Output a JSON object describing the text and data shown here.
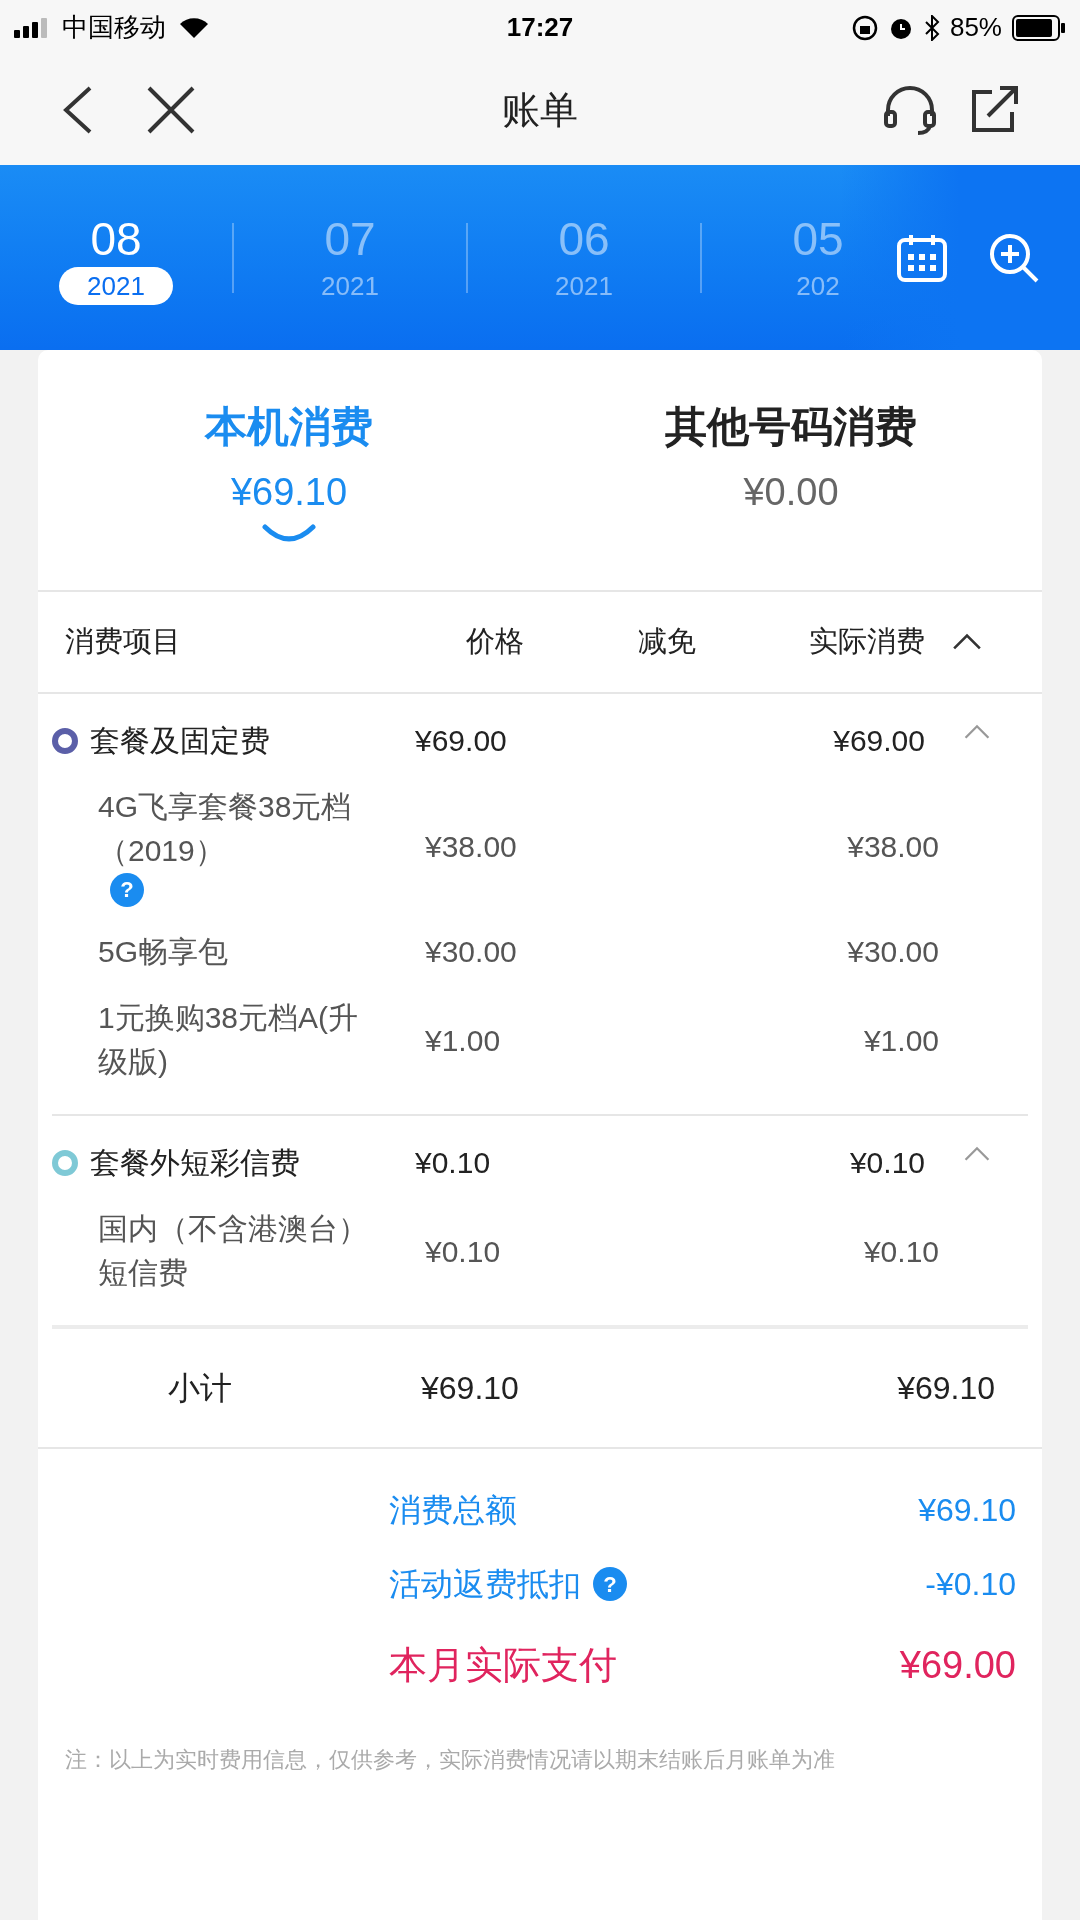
{
  "status_bar": {
    "carrier": "中国移动",
    "time": "17:27",
    "battery": "85%"
  },
  "nav": {
    "title": "账单"
  },
  "months": [
    {
      "month": "08",
      "year": "2021",
      "selected": true
    },
    {
      "month": "07",
      "year": "2021",
      "selected": false
    },
    {
      "month": "06",
      "year": "2021",
      "selected": false
    },
    {
      "month": "05",
      "year": "202",
      "selected": false
    }
  ],
  "summary_tabs": [
    {
      "label": "本机消费",
      "amount": "¥69.10",
      "selected": true
    },
    {
      "label": "其他号码消费",
      "amount": "¥0.00",
      "selected": false
    }
  ],
  "table": {
    "columns": [
      "消费项目",
      "价格",
      "减免",
      "实际消费"
    ],
    "expanded": true,
    "groups": [
      {
        "name": "套餐及固定费",
        "price": "¥69.00",
        "actual": "¥69.00",
        "color": "#5b5fa8",
        "expanded": true,
        "items": [
          {
            "name": "4G飞享套餐38元档（2019）",
            "price": "¥38.00",
            "actual": "¥38.00",
            "help": "?"
          },
          {
            "name": "5G畅享包",
            "price": "¥30.00",
            "actual": "¥30.00"
          },
          {
            "name": "1元换购38元档A(升级版)",
            "price": "¥1.00",
            "actual": "¥1.00"
          }
        ]
      },
      {
        "name": "套餐外短彩信费",
        "price": "¥0.10",
        "actual": "¥0.10",
        "color": "#7fc9d6",
        "expanded": true,
        "items": [
          {
            "name": "国内（不含港澳台）短信费",
            "price": "¥0.10",
            "actual": "¥0.10"
          }
        ]
      }
    ],
    "subtotal": {
      "label": "小计",
      "price": "¥69.10",
      "actual": "¥69.10"
    }
  },
  "totals": [
    {
      "label": "消费总额",
      "value": "¥69.10",
      "kind": "normal"
    },
    {
      "label": "活动返费抵扣",
      "value": "-¥0.10",
      "kind": "normal",
      "help": "?"
    },
    {
      "label": "本月实际支付",
      "value": "¥69.00",
      "kind": "final"
    }
  ],
  "note": "注：以上为实时费用信息，仅供参考，实际消费情况请以期末结账后月账单为准"
}
